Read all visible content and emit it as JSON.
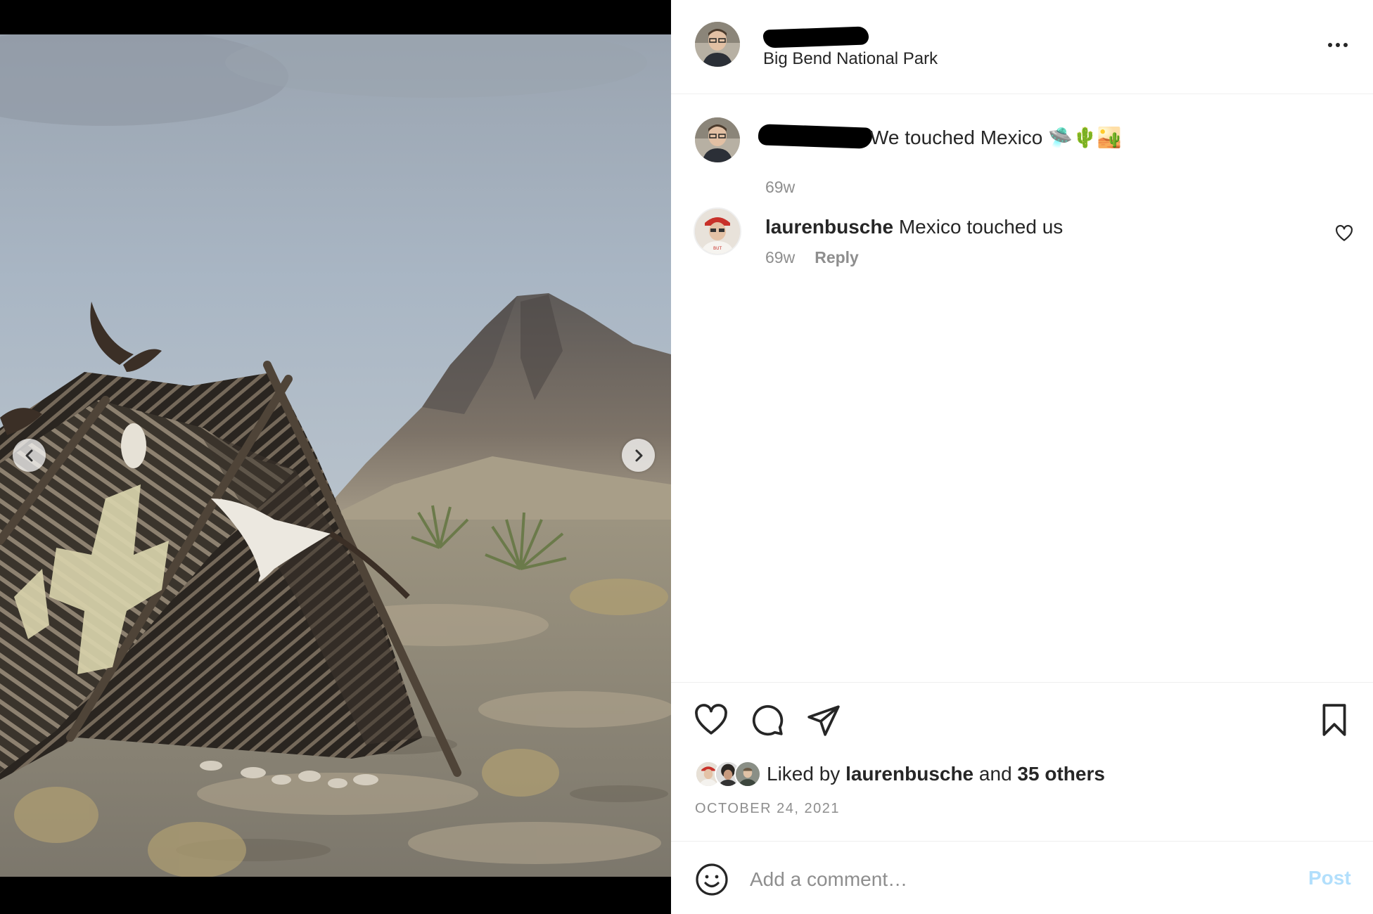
{
  "media": {
    "prev_icon": "chevron-left-icon",
    "next_icon": "chevron-right-icon"
  },
  "header": {
    "location": "Big Bend National Park",
    "more_icon": "more-horizontal-icon"
  },
  "comments": [
    {
      "username": "",
      "text": "We touched Mexico 🛸🌵🏜️",
      "time": "69w"
    },
    {
      "username": "laurenbusche",
      "text": "Mexico touched us",
      "time": "69w",
      "reply_label": "Reply"
    }
  ],
  "actions": {
    "like_icon": "heart-icon",
    "comment_icon": "comment-icon",
    "share_icon": "share-icon",
    "save_icon": "bookmark-icon"
  },
  "likes": {
    "prefix": "Liked by",
    "user": "laurenbusche",
    "joiner": "and",
    "others": "35 others"
  },
  "date": "OCTOBER 24, 2021",
  "add_comment": {
    "placeholder": "Add a comment…",
    "post_label": "Post",
    "emoji_icon": "smiley-icon"
  },
  "colors": {
    "text": "#262626",
    "secondary": "#8e8e8e",
    "post_disabled": "#b2dffc",
    "divider": "#efefef"
  }
}
